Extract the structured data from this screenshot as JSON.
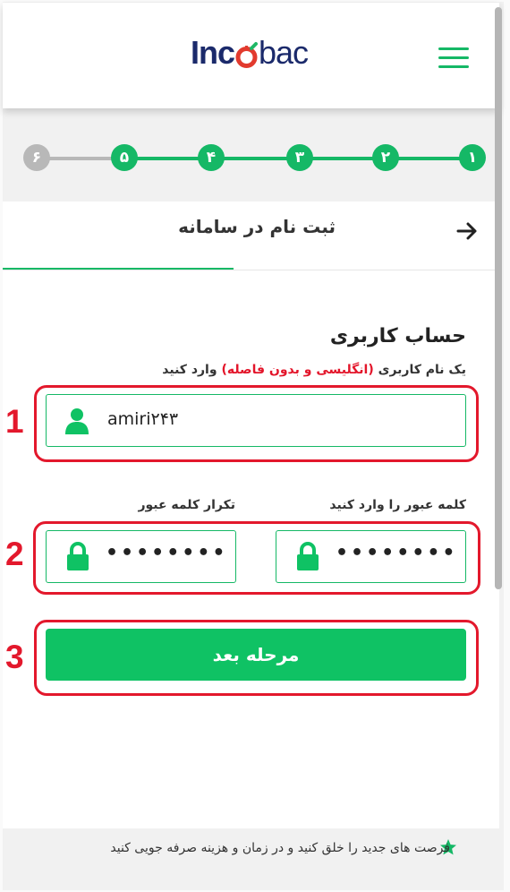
{
  "header": {
    "logo_part1": "Inc",
    "logo_part2": "bac",
    "menu_icon": "hamburger-icon"
  },
  "stepper": {
    "steps": [
      {
        "label": "۱",
        "state": "completed"
      },
      {
        "label": "۲",
        "state": "completed"
      },
      {
        "label": "۳",
        "state": "completed"
      },
      {
        "label": "۴",
        "state": "completed"
      },
      {
        "label": "۵",
        "state": "completed"
      },
      {
        "label": "۶",
        "state": "pending"
      }
    ]
  },
  "page": {
    "title": "ثبت نام در سامانه",
    "back_icon": "arrow-right-icon"
  },
  "form": {
    "section_title": "حساب کاربری",
    "username_hint_start": "یک نام کاربری ",
    "username_hint_red": "(انگلیسی و بدون فاصله)",
    "username_hint_end": " وارد کنید",
    "username_value": "amiri۲۴۳",
    "password_label": "کلمه عبور را وارد کنید",
    "password_value": "••••••••",
    "confirm_label": "تکرار کلمه عبور",
    "confirm_value": "••••••••",
    "next_button": "مرحله بعد"
  },
  "annotations": {
    "labels": [
      "1",
      "2",
      "3"
    ],
    "color": "#e3182c"
  },
  "footer": {
    "text": "فرصت های جدید را خلق کنید و در زمان و هزینه صرفه جویی کنید",
    "icon": "star-icon"
  },
  "colors": {
    "accent": "#15b866",
    "button": "#0fc264",
    "pending": "#b8b8b8",
    "brand_navy": "#1b2a6b",
    "brand_red": "#e23a2e"
  }
}
